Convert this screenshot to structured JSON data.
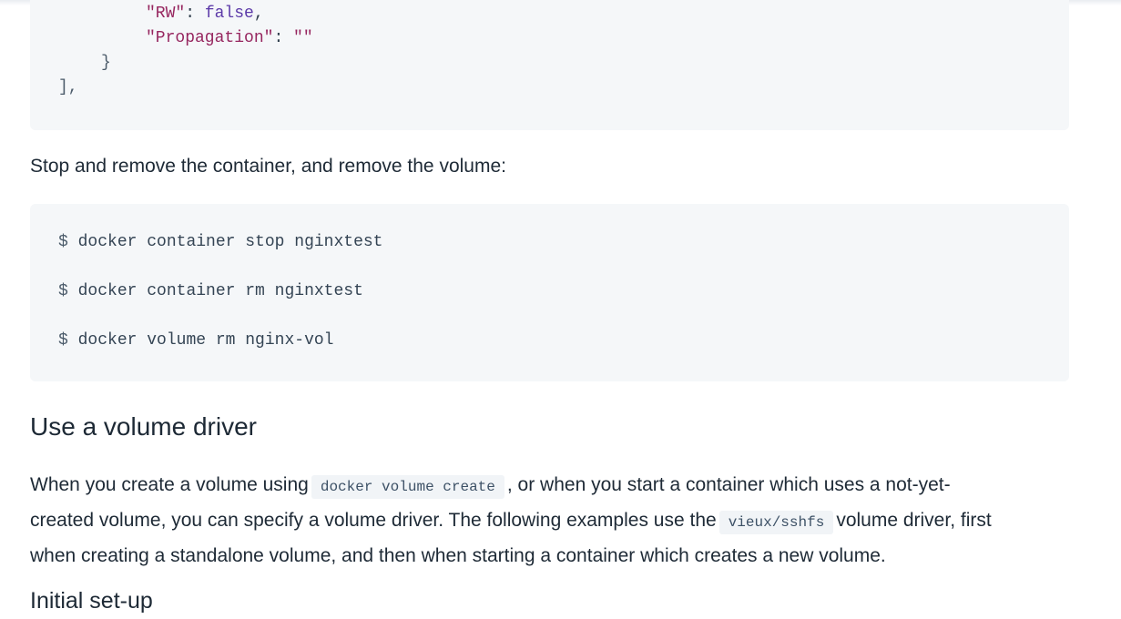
{
  "top_code": {
    "line1": {
      "key": "\"RW\"",
      "sep": ": ",
      "value": "false",
      "end": ","
    },
    "line2": {
      "key": "\"Propagation\"",
      "sep": ": ",
      "value": "\"\""
    },
    "line3": "}",
    "line4": "],"
  },
  "stop_paragraph": "Stop and remove the container, and remove the volume:",
  "stop_commands": [
    {
      "prompt": "$",
      "command": "docker container stop nginxtest"
    },
    {
      "prompt": "$",
      "command": "docker container rm nginxtest"
    },
    {
      "prompt": "$",
      "command": "docker volume rm nginx-vol"
    }
  ],
  "section_heading": "Use a volume driver",
  "driver_paragraph": {
    "line1_before": "When you create a volume using",
    "inline_code_1": "docker volume create",
    "line1_after": ", or when you start a container which uses a not-yet-",
    "line2_before": "created volume, you can specify a volume driver. The following examples use the",
    "inline_code_2": "vieux/sshfs",
    "line2_after": "volume driver, first",
    "line3": "when creating a standalone volume, and then when starting a container which creates a new volume."
  },
  "subheading": "Initial set-up"
}
